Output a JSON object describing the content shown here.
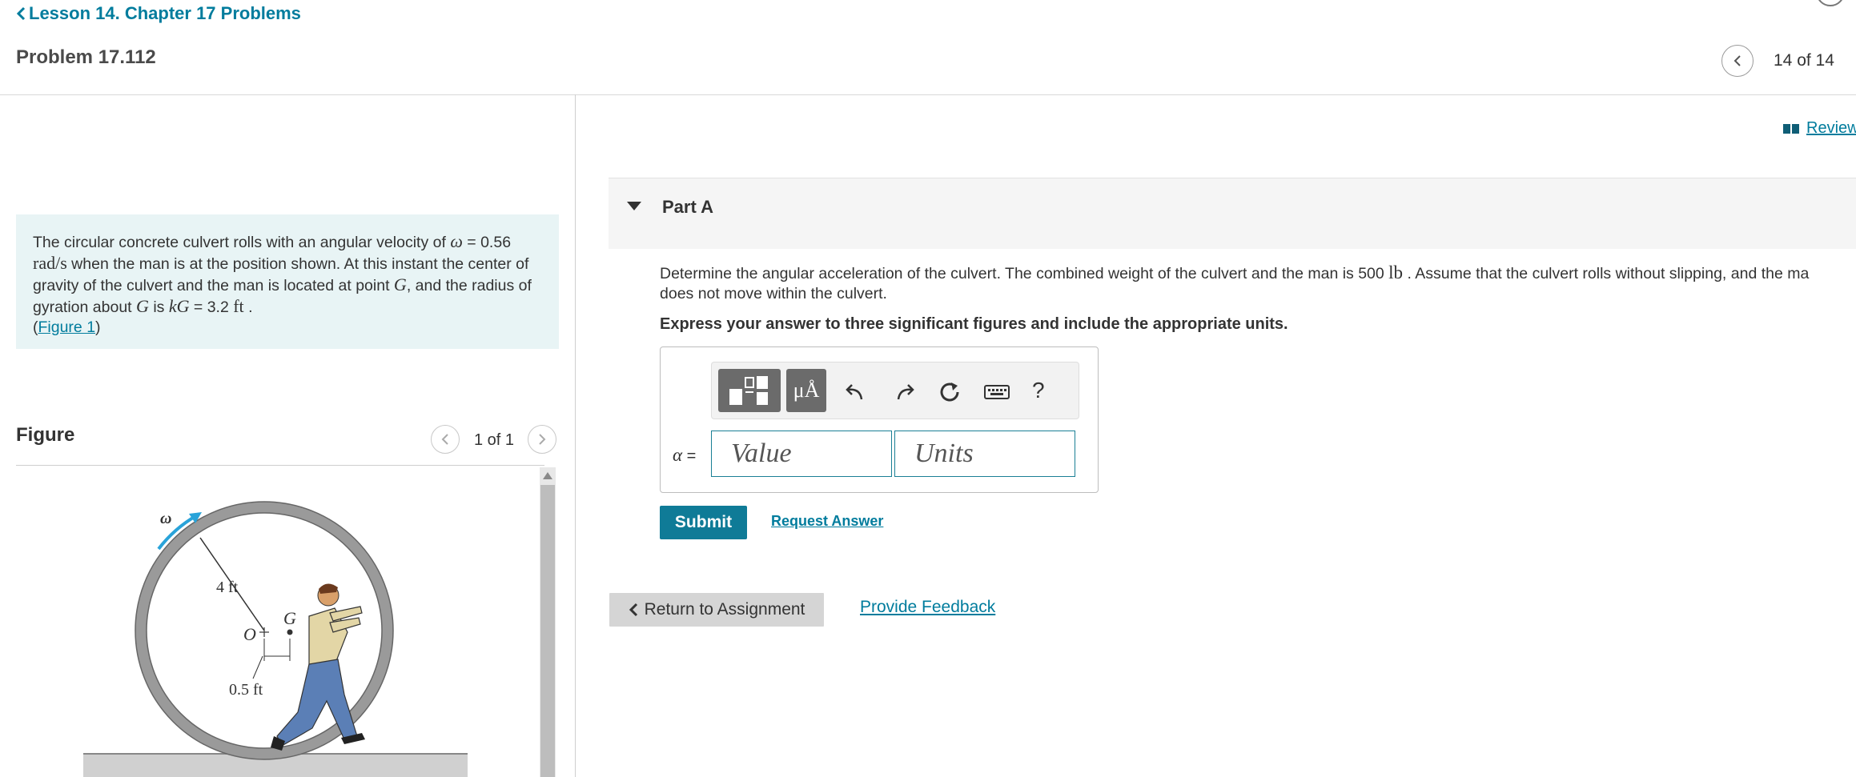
{
  "header": {
    "back_link": "Lesson 14. Chapter 17 Problems",
    "problem_title": "Problem 17.112",
    "nav_count": "14 of 14"
  },
  "intro": {
    "t1": "The circular concrete culvert rolls with an angular velocity of ",
    "omega": "ω",
    "t2": " = 0.56",
    "rad_s": "rad/s",
    "t3": " when the man is at the position shown. At this instant the center of gravity of the culvert and the man is located at point ",
    "G": "G",
    "t4": ", and the radius of gyration about ",
    "G2": "G",
    "t5": " is ",
    "kG": "kG",
    "t6": " = 3.2 ",
    "ft": "ft",
    "t7": " .",
    "figure_link_pre": "(",
    "figure_link": "Figure 1",
    "figure_link_post": ")"
  },
  "figure": {
    "heading": "Figure",
    "count": "1 of 1",
    "labels": {
      "omega": "ω",
      "radius": "4 ft",
      "G": "G",
      "O": "O",
      "offset": "0.5 ft"
    }
  },
  "review": {
    "label": "Review"
  },
  "part": {
    "title": "Part A",
    "question_1": "Determine the angular acceleration of the culvert. The combined weight of the culvert and the man is 500 ",
    "lb": "lb",
    "question_2": " . Assume that the culvert rolls without slipping, and the ma",
    "question_3": "does not move within the culvert.",
    "instruction": "Express your answer to three significant figures and include the appropriate units."
  },
  "answer": {
    "units_btn": "μÅ",
    "help": "?",
    "alpha_symbol": "α",
    "alpha_eq": " =",
    "value_placeholder": "Value",
    "units_placeholder": "Units",
    "submit": "Submit",
    "request_answer": "Request Answer"
  },
  "footer": {
    "return": "Return to Assignment",
    "feedback": "Provide Feedback"
  },
  "colors": {
    "link": "#007c9d",
    "intro_bg": "#e8f4f5",
    "submit_bg": "#0f7b97",
    "return_bg": "#d5d5d5",
    "input_border": "#1a7f95",
    "arrow": "#29a3d9"
  }
}
